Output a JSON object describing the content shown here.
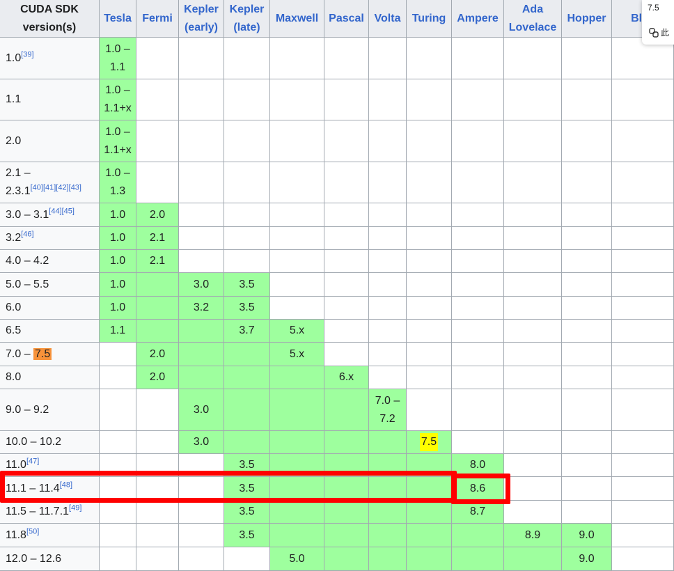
{
  "table": {
    "columns": [
      {
        "label": "CUDA SDK\nversion(s)",
        "link": false
      },
      {
        "label": "Tesla",
        "link": true
      },
      {
        "label": "Fermi",
        "link": true
      },
      {
        "label": "Kepler\n(early)",
        "link": true
      },
      {
        "label": "Kepler\n(late)",
        "link": true
      },
      {
        "label": "Maxwell",
        "link": true
      },
      {
        "label": "Pascal",
        "link": true
      },
      {
        "label": "Volta",
        "link": true
      },
      {
        "label": "Turing",
        "link": true
      },
      {
        "label": "Ampere",
        "link": true
      },
      {
        "label": "Ada\nLovelace",
        "link": true
      },
      {
        "label": "Hopper",
        "link": true
      },
      {
        "label": "Blac",
        "link": true
      }
    ],
    "rows": [
      {
        "version": "1.0",
        "refs": "[39]",
        "cells": [
          {
            "v": "1.0 –\n1.1",
            "g": true
          },
          {
            "v": "",
            "g": false
          },
          {
            "v": "",
            "g": false
          },
          {
            "v": "",
            "g": false
          },
          {
            "v": "",
            "g": false
          },
          {
            "v": "",
            "g": false
          },
          {
            "v": "",
            "g": false
          },
          {
            "v": "",
            "g": false
          },
          {
            "v": "",
            "g": false
          },
          {
            "v": "",
            "g": false
          },
          {
            "v": "",
            "g": false
          },
          {
            "v": "",
            "g": false
          }
        ]
      },
      {
        "version": "1.1",
        "refs": "",
        "cells": [
          {
            "v": "1.0 –\n1.1+x",
            "g": true
          },
          {
            "v": "",
            "g": false
          },
          {
            "v": "",
            "g": false
          },
          {
            "v": "",
            "g": false
          },
          {
            "v": "",
            "g": false
          },
          {
            "v": "",
            "g": false
          },
          {
            "v": "",
            "g": false
          },
          {
            "v": "",
            "g": false
          },
          {
            "v": "",
            "g": false
          },
          {
            "v": "",
            "g": false
          },
          {
            "v": "",
            "g": false
          },
          {
            "v": "",
            "g": false
          }
        ]
      },
      {
        "version": "2.0",
        "refs": "",
        "cells": [
          {
            "v": "1.0 –\n1.1+x",
            "g": true
          },
          {
            "v": "",
            "g": false
          },
          {
            "v": "",
            "g": false
          },
          {
            "v": "",
            "g": false
          },
          {
            "v": "",
            "g": false
          },
          {
            "v": "",
            "g": false
          },
          {
            "v": "",
            "g": false
          },
          {
            "v": "",
            "g": false
          },
          {
            "v": "",
            "g": false
          },
          {
            "v": "",
            "g": false
          },
          {
            "v": "",
            "g": false
          },
          {
            "v": "",
            "g": false
          }
        ]
      },
      {
        "version": "2.1 –\n2.3.1",
        "refs": "[40][41][42][43]",
        "cells": [
          {
            "v": "1.0 –\n1.3",
            "g": true
          },
          {
            "v": "",
            "g": false
          },
          {
            "v": "",
            "g": false
          },
          {
            "v": "",
            "g": false
          },
          {
            "v": "",
            "g": false
          },
          {
            "v": "",
            "g": false
          },
          {
            "v": "",
            "g": false
          },
          {
            "v": "",
            "g": false
          },
          {
            "v": "",
            "g": false
          },
          {
            "v": "",
            "g": false
          },
          {
            "v": "",
            "g": false
          },
          {
            "v": "",
            "g": false
          }
        ]
      },
      {
        "version": "3.0 – 3.1",
        "refs": "[44][45]",
        "cells": [
          {
            "v": "1.0",
            "g": true
          },
          {
            "v": "2.0",
            "g": true
          },
          {
            "v": "",
            "g": false
          },
          {
            "v": "",
            "g": false
          },
          {
            "v": "",
            "g": false
          },
          {
            "v": "",
            "g": false
          },
          {
            "v": "",
            "g": false
          },
          {
            "v": "",
            "g": false
          },
          {
            "v": "",
            "g": false
          },
          {
            "v": "",
            "g": false
          },
          {
            "v": "",
            "g": false
          },
          {
            "v": "",
            "g": false
          }
        ]
      },
      {
        "version": "3.2",
        "refs": "[46]",
        "cells": [
          {
            "v": "1.0",
            "g": true
          },
          {
            "v": "2.1",
            "g": true
          },
          {
            "v": "",
            "g": false
          },
          {
            "v": "",
            "g": false
          },
          {
            "v": "",
            "g": false
          },
          {
            "v": "",
            "g": false
          },
          {
            "v": "",
            "g": false
          },
          {
            "v": "",
            "g": false
          },
          {
            "v": "",
            "g": false
          },
          {
            "v": "",
            "g": false
          },
          {
            "v": "",
            "g": false
          },
          {
            "v": "",
            "g": false
          }
        ]
      },
      {
        "version": "4.0 – 4.2",
        "refs": "",
        "cells": [
          {
            "v": "1.0",
            "g": true
          },
          {
            "v": "2.1",
            "g": true
          },
          {
            "v": "",
            "g": false
          },
          {
            "v": "",
            "g": false
          },
          {
            "v": "",
            "g": false
          },
          {
            "v": "",
            "g": false
          },
          {
            "v": "",
            "g": false
          },
          {
            "v": "",
            "g": false
          },
          {
            "v": "",
            "g": false
          },
          {
            "v": "",
            "g": false
          },
          {
            "v": "",
            "g": false
          },
          {
            "v": "",
            "g": false
          }
        ]
      },
      {
        "version": "5.0 – 5.5",
        "refs": "",
        "cells": [
          {
            "v": "1.0",
            "g": true
          },
          {
            "v": "",
            "g": true
          },
          {
            "v": "3.0",
            "g": true
          },
          {
            "v": "3.5",
            "g": true
          },
          {
            "v": "",
            "g": false
          },
          {
            "v": "",
            "g": false
          },
          {
            "v": "",
            "g": false
          },
          {
            "v": "",
            "g": false
          },
          {
            "v": "",
            "g": false
          },
          {
            "v": "",
            "g": false
          },
          {
            "v": "",
            "g": false
          },
          {
            "v": "",
            "g": false
          }
        ]
      },
      {
        "version": "6.0",
        "refs": "",
        "cells": [
          {
            "v": "1.0",
            "g": true
          },
          {
            "v": "",
            "g": true
          },
          {
            "v": "3.2",
            "g": true
          },
          {
            "v": "3.5",
            "g": true
          },
          {
            "v": "",
            "g": false
          },
          {
            "v": "",
            "g": false
          },
          {
            "v": "",
            "g": false
          },
          {
            "v": "",
            "g": false
          },
          {
            "v": "",
            "g": false
          },
          {
            "v": "",
            "g": false
          },
          {
            "v": "",
            "g": false
          },
          {
            "v": "",
            "g": false
          }
        ]
      },
      {
        "version": "6.5",
        "refs": "",
        "cells": [
          {
            "v": "1.1",
            "g": true
          },
          {
            "v": "",
            "g": true
          },
          {
            "v": "",
            "g": true
          },
          {
            "v": "3.7",
            "g": true
          },
          {
            "v": "5.x",
            "g": true
          },
          {
            "v": "",
            "g": false
          },
          {
            "v": "",
            "g": false
          },
          {
            "v": "",
            "g": false
          },
          {
            "v": "",
            "g": false
          },
          {
            "v": "",
            "g": false
          },
          {
            "v": "",
            "g": false
          },
          {
            "v": "",
            "g": false
          }
        ]
      },
      {
        "version": "7.0 – ",
        "version_mark": "7.5",
        "refs": "",
        "cells": [
          {
            "v": "",
            "g": false
          },
          {
            "v": "2.0",
            "g": true
          },
          {
            "v": "",
            "g": true
          },
          {
            "v": "",
            "g": true
          },
          {
            "v": "5.x",
            "g": true
          },
          {
            "v": "",
            "g": false
          },
          {
            "v": "",
            "g": false
          },
          {
            "v": "",
            "g": false
          },
          {
            "v": "",
            "g": false
          },
          {
            "v": "",
            "g": false
          },
          {
            "v": "",
            "g": false
          },
          {
            "v": "",
            "g": false
          }
        ]
      },
      {
        "version": "8.0",
        "refs": "",
        "cells": [
          {
            "v": "",
            "g": false
          },
          {
            "v": "2.0",
            "g": true
          },
          {
            "v": "",
            "g": true
          },
          {
            "v": "",
            "g": true
          },
          {
            "v": "",
            "g": true
          },
          {
            "v": "6.x",
            "g": true
          },
          {
            "v": "",
            "g": false
          },
          {
            "v": "",
            "g": false
          },
          {
            "v": "",
            "g": false
          },
          {
            "v": "",
            "g": false
          },
          {
            "v": "",
            "g": false
          },
          {
            "v": "",
            "g": false
          }
        ]
      },
      {
        "version": "9.0 – 9.2",
        "refs": "",
        "cells": [
          {
            "v": "",
            "g": false
          },
          {
            "v": "",
            "g": false
          },
          {
            "v": "3.0",
            "g": true
          },
          {
            "v": "",
            "g": true
          },
          {
            "v": "",
            "g": true
          },
          {
            "v": "",
            "g": true
          },
          {
            "v": "7.0 –\n7.2",
            "g": true
          },
          {
            "v": "",
            "g": false
          },
          {
            "v": "",
            "g": false
          },
          {
            "v": "",
            "g": false
          },
          {
            "v": "",
            "g": false
          },
          {
            "v": "",
            "g": false
          }
        ]
      },
      {
        "version": "10.0 – 10.2",
        "refs": "",
        "cells": [
          {
            "v": "",
            "g": false
          },
          {
            "v": "",
            "g": false
          },
          {
            "v": "3.0",
            "g": true
          },
          {
            "v": "",
            "g": true
          },
          {
            "v": "",
            "g": true
          },
          {
            "v": "",
            "g": true
          },
          {
            "v": "",
            "g": true
          },
          {
            "v": "",
            "g": true,
            "mark": "7.5"
          },
          {
            "v": "",
            "g": false
          },
          {
            "v": "",
            "g": false
          },
          {
            "v": "",
            "g": false
          },
          {
            "v": "",
            "g": false
          }
        ]
      },
      {
        "version": "11.0",
        "refs": "[47]",
        "cells": [
          {
            "v": "",
            "g": false
          },
          {
            "v": "",
            "g": false
          },
          {
            "v": "",
            "g": false
          },
          {
            "v": "3.5",
            "g": true
          },
          {
            "v": "",
            "g": true
          },
          {
            "v": "",
            "g": true
          },
          {
            "v": "",
            "g": true
          },
          {
            "v": "",
            "g": true
          },
          {
            "v": "8.0",
            "g": true
          },
          {
            "v": "",
            "g": false
          },
          {
            "v": "",
            "g": false
          },
          {
            "v": "",
            "g": false
          }
        ]
      },
      {
        "version": "11.1 – 11.4",
        "refs": "[48]",
        "cells": [
          {
            "v": "",
            "g": false
          },
          {
            "v": "",
            "g": false
          },
          {
            "v": "",
            "g": false
          },
          {
            "v": "3.5",
            "g": true
          },
          {
            "v": "",
            "g": true
          },
          {
            "v": "",
            "g": true
          },
          {
            "v": "",
            "g": true
          },
          {
            "v": "",
            "g": true
          },
          {
            "v": "8.6",
            "g": true
          },
          {
            "v": "",
            "g": false
          },
          {
            "v": "",
            "g": false
          },
          {
            "v": "",
            "g": false
          }
        ]
      },
      {
        "version": "11.5 – 11.7.1",
        "refs": "[49]",
        "cells": [
          {
            "v": "",
            "g": false
          },
          {
            "v": "",
            "g": false
          },
          {
            "v": "",
            "g": false
          },
          {
            "v": "3.5",
            "g": true
          },
          {
            "v": "",
            "g": true
          },
          {
            "v": "",
            "g": true
          },
          {
            "v": "",
            "g": true
          },
          {
            "v": "",
            "g": true
          },
          {
            "v": "8.7",
            "g": true
          },
          {
            "v": "",
            "g": false
          },
          {
            "v": "",
            "g": false
          },
          {
            "v": "",
            "g": false
          }
        ]
      },
      {
        "version": "11.8",
        "refs": "[50]",
        "cells": [
          {
            "v": "",
            "g": false
          },
          {
            "v": "",
            "g": false
          },
          {
            "v": "",
            "g": false
          },
          {
            "v": "3.5",
            "g": true
          },
          {
            "v": "",
            "g": true
          },
          {
            "v": "",
            "g": true
          },
          {
            "v": "",
            "g": true
          },
          {
            "v": "",
            "g": true
          },
          {
            "v": "",
            "g": true
          },
          {
            "v": "8.9",
            "g": true
          },
          {
            "v": "9.0",
            "g": true
          },
          {
            "v": "",
            "g": false
          }
        ]
      },
      {
        "version": "12.0 – 12.6",
        "refs": "",
        "cells": [
          {
            "v": "",
            "g": false
          },
          {
            "v": "",
            "g": false
          },
          {
            "v": "",
            "g": false
          },
          {
            "v": "",
            "g": false
          },
          {
            "v": "5.0",
            "g": true
          },
          {
            "v": "",
            "g": true
          },
          {
            "v": "",
            "g": true
          },
          {
            "v": "",
            "g": true
          },
          {
            "v": "",
            "g": true
          },
          {
            "v": "",
            "g": true
          },
          {
            "v": "9.0",
            "g": true
          },
          {
            "v": "",
            "g": false
          }
        ]
      }
    ]
  },
  "popup": {
    "selection_text": "7.5",
    "action_icon": "copilot-icon",
    "action_label": "此"
  },
  "colors": {
    "supported": "#9eff9e",
    "header_bg": "#eaecf0",
    "link": "#3366cc",
    "highlight_orange": "#f7923a",
    "highlight_yellow": "#ffff00",
    "annotation_red": "#ff0000"
  }
}
